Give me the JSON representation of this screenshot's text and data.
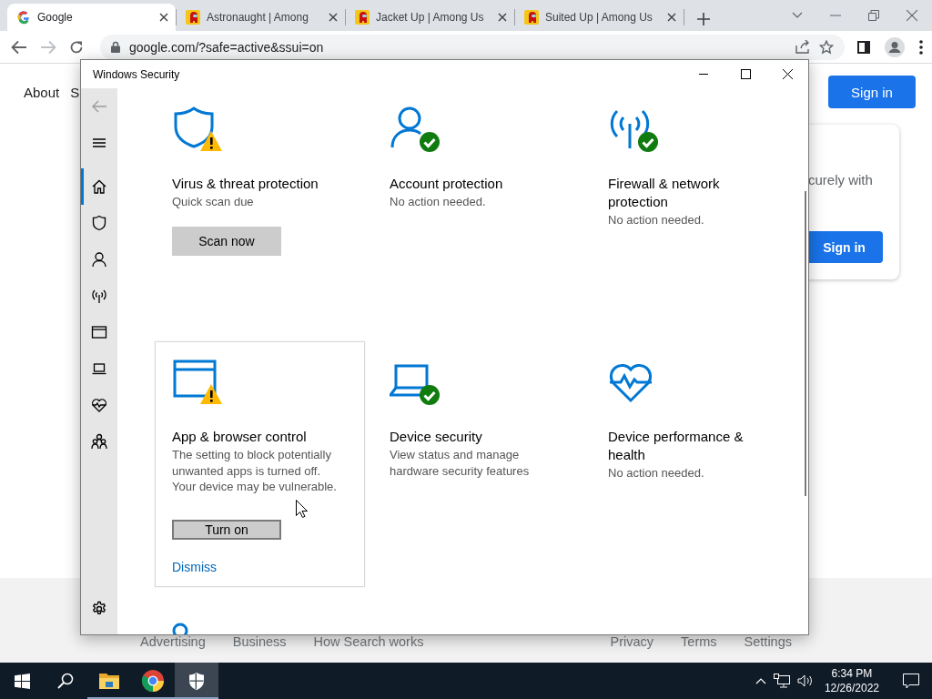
{
  "browser": {
    "tabs": [
      {
        "title": "Google",
        "kind": "g",
        "selected": true
      },
      {
        "title": "Astronaught | Among",
        "kind": "figure",
        "selected": false
      },
      {
        "title": "Jacket Up | Among Us",
        "kind": "figure",
        "selected": false
      },
      {
        "title": "Suited Up | Among Us",
        "kind": "figure",
        "selected": false
      }
    ],
    "address": "google.com/?safe=active&ssui=on",
    "forward_disabled": true
  },
  "google_page": {
    "header_links": [
      "About",
      "S"
    ],
    "sign_in": "Sign in",
    "card_text": "curely with",
    "card_button": "Sign in",
    "footer_left": [
      "Advertising",
      "Business",
      "How Search works"
    ],
    "footer_right": [
      "Privacy",
      "Terms",
      "Settings"
    ]
  },
  "security_window": {
    "title": "Windows Security",
    "nav": [
      {
        "kind": "back",
        "selected": false,
        "disabled": true
      },
      {
        "kind": "menu",
        "selected": false,
        "disabled": false
      },
      {
        "kind": "home",
        "selected": true,
        "disabled": false
      },
      {
        "kind": "shield",
        "selected": false,
        "disabled": false
      },
      {
        "kind": "person",
        "selected": false,
        "disabled": false
      },
      {
        "kind": "antenna",
        "selected": false,
        "disabled": false
      },
      {
        "kind": "window",
        "selected": false,
        "disabled": false
      },
      {
        "kind": "laptop",
        "selected": false,
        "disabled": false
      },
      {
        "kind": "heart",
        "selected": false,
        "disabled": false
      },
      {
        "kind": "family",
        "selected": false,
        "disabled": false
      },
      {
        "kind": "settings",
        "selected": false,
        "disabled": false
      }
    ],
    "tiles": [
      {
        "kind": "shield",
        "badge": {
          "kind": "warning"
        },
        "title": "Virus & threat protection",
        "description": "Quick scan due",
        "button": {
          "label": "Scan now",
          "focused": false
        },
        "highlighted": false
      },
      {
        "kind": "person",
        "badge": {
          "kind": "check"
        },
        "title": "Account protection",
        "description": "No action needed.",
        "highlighted": false
      },
      {
        "kind": "antenna",
        "badge": {
          "kind": "check"
        },
        "title": "Firewall & network protection",
        "description": "No action needed.",
        "highlighted": false
      },
      {
        "kind": "window",
        "badge": {
          "kind": "warning"
        },
        "title": "App & browser control",
        "description": "The setting to block potentially unwanted apps is turned off. Your device may be vulnerable.",
        "button": {
          "label": "Turn on",
          "focused": true
        },
        "link": "Dismiss",
        "highlighted": true
      },
      {
        "kind": "laptop",
        "badge": {
          "kind": "check"
        },
        "title": "Device security",
        "description": "View status and manage hardware security features",
        "highlighted": false
      },
      {
        "kind": "heart",
        "title": "Device performance & health",
        "description": "No action needed.",
        "highlighted": false
      },
      {
        "kind": "ring",
        "highlighted": false
      }
    ]
  },
  "taskbar": {
    "apps": [
      {
        "kind": "start",
        "running": false,
        "active": false
      },
      {
        "kind": "search",
        "running": false,
        "active": false
      },
      {
        "kind": "folder",
        "running": true,
        "active": false
      },
      {
        "kind": "browser",
        "running": true,
        "active": false
      },
      {
        "kind": "shield",
        "running": true,
        "active": true
      }
    ],
    "time": "6:34 PM",
    "date": "12/26/2022"
  }
}
